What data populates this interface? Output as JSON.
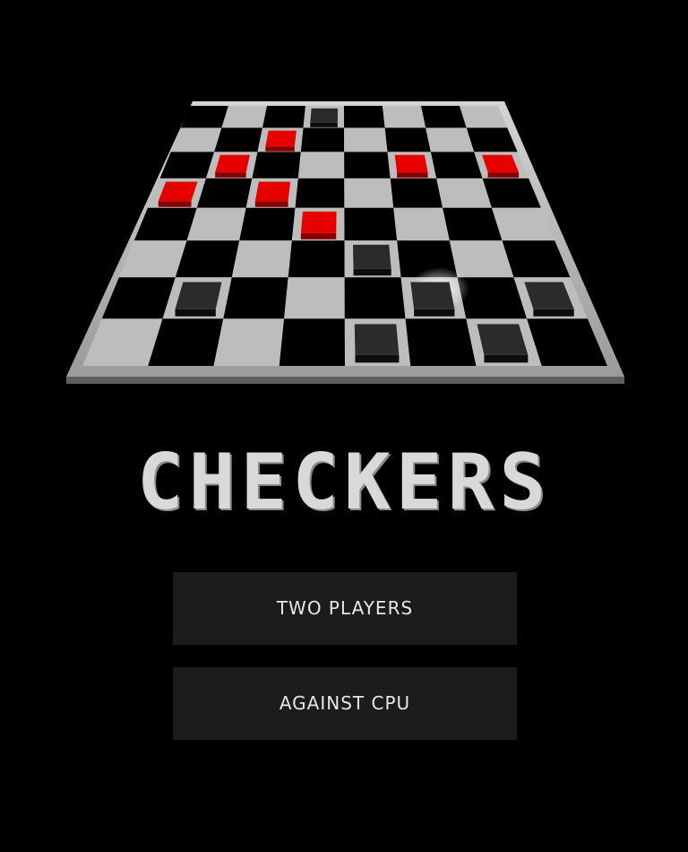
{
  "title": "CHECKERS",
  "menu": {
    "two_players_label": "TWO PLAYERS",
    "against_cpu_label": "AGAINST CPU"
  },
  "board": {
    "rows": 8,
    "cols": 8,
    "light_square_color": "#bdbdbd",
    "dark_square_color": "#000000",
    "frame_color": "#b3b3b3",
    "pieces": [
      {
        "color": "black",
        "row": 0,
        "col": 3
      },
      {
        "color": "red",
        "row": 1,
        "col": 2
      },
      {
        "color": "red",
        "row": 2,
        "col": 1
      },
      {
        "color": "red",
        "row": 2,
        "col": 5
      },
      {
        "color": "red",
        "row": 2,
        "col": 7
      },
      {
        "color": "red",
        "row": 3,
        "col": 0
      },
      {
        "color": "red",
        "row": 3,
        "col": 2
      },
      {
        "color": "red",
        "row": 4,
        "col": 3
      },
      {
        "color": "black",
        "row": 5,
        "col": 4
      },
      {
        "color": "black",
        "row": 6,
        "col": 1
      },
      {
        "color": "black",
        "row": 6,
        "col": 5
      },
      {
        "color": "black",
        "row": 6,
        "col": 7
      },
      {
        "color": "black",
        "row": 7,
        "col": 4
      },
      {
        "color": "black",
        "row": 7,
        "col": 6
      }
    ],
    "piece_colors": {
      "red": "#e60000",
      "black": "#2b2b2b"
    }
  }
}
